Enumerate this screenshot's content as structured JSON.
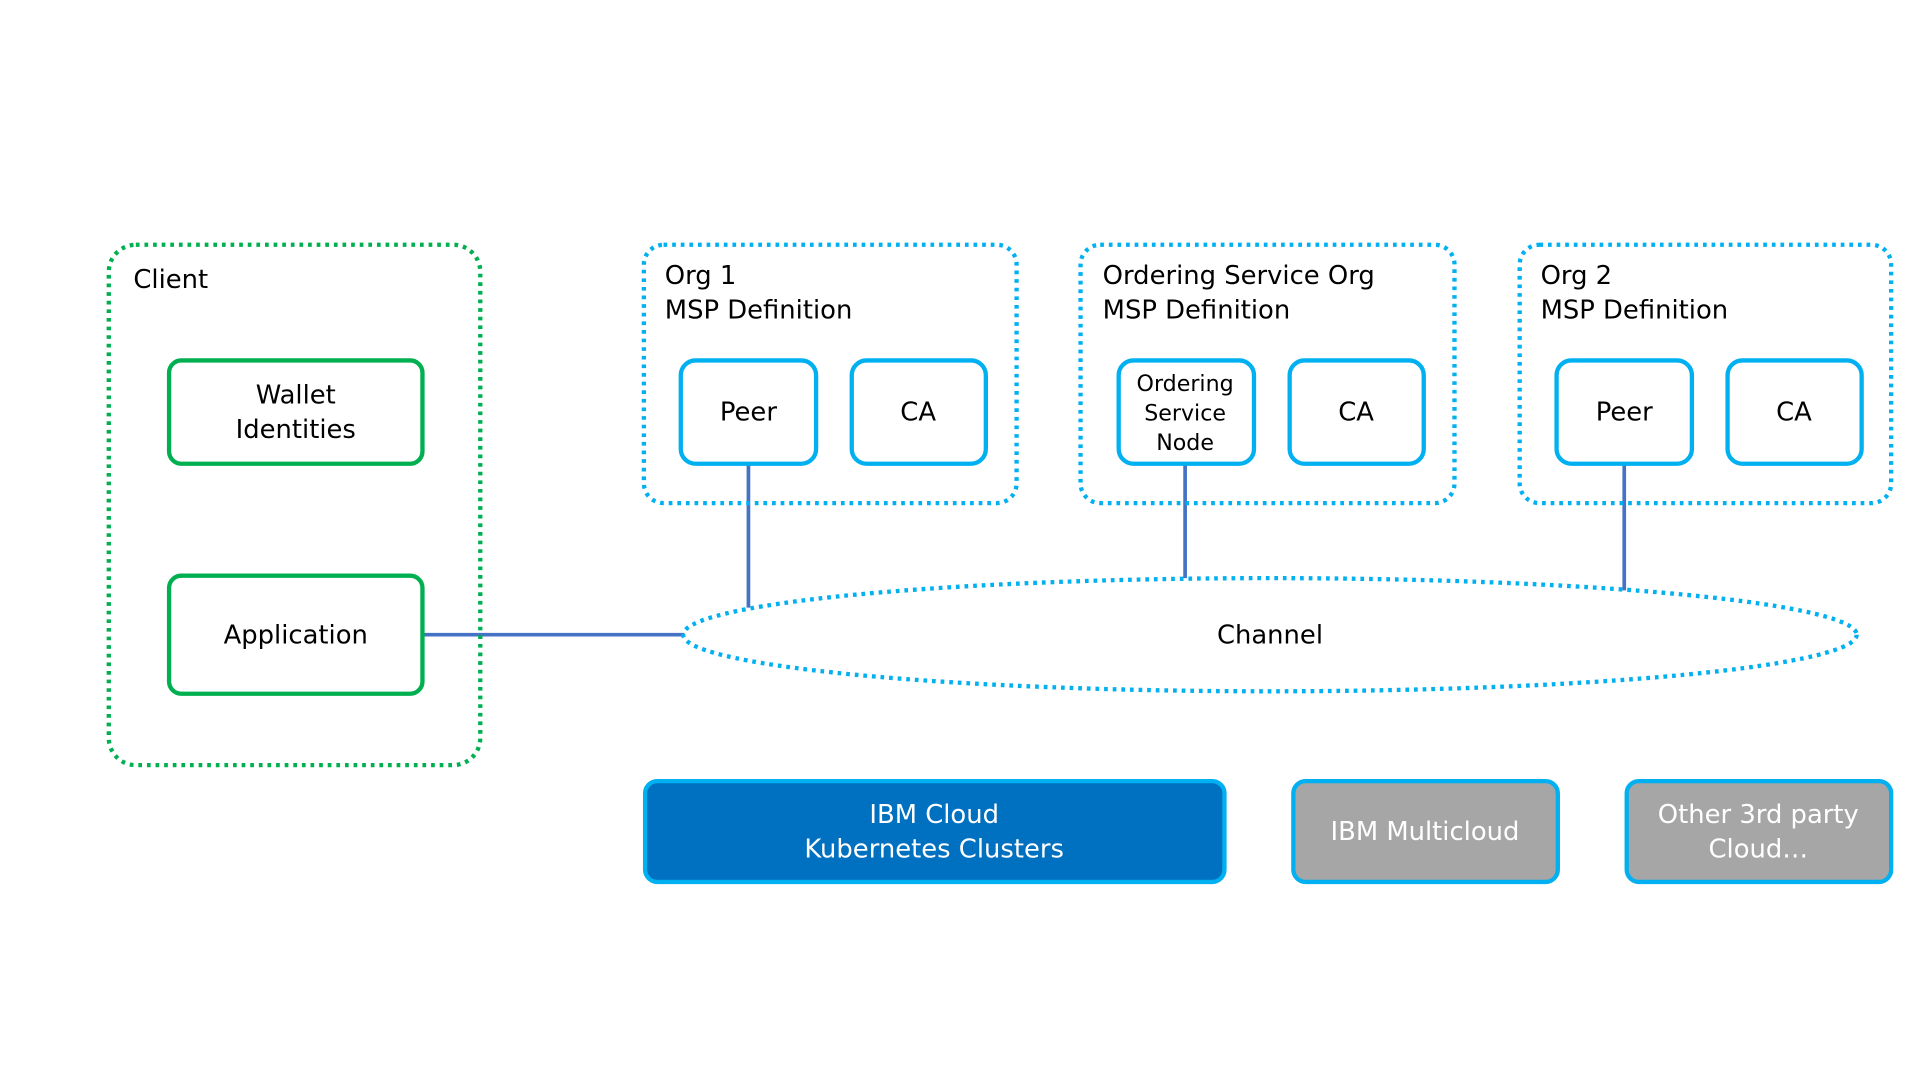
{
  "colors": {
    "client_border": "#00b050",
    "org_border": "#00b0f0",
    "connector": "#4472c4",
    "ibm_cloud_fill": "#0070c0",
    "other_cloud_fill": "#a6a6a6"
  },
  "client": {
    "title": "Client",
    "wallet": [
      "Wallet",
      "Identities"
    ],
    "application": "Application"
  },
  "org1": {
    "title": [
      "Org 1",
      "MSP Definition"
    ],
    "peer": "Peer",
    "ca": "CA"
  },
  "ordering_org": {
    "title": [
      "Ordering Service Org",
      "MSP Definition"
    ],
    "node": [
      "Ordering",
      "Service",
      "Node"
    ],
    "ca": "CA"
  },
  "org2": {
    "title": [
      "Org 2",
      "MSP Definition"
    ],
    "peer": "Peer",
    "ca": "CA"
  },
  "channel": "Channel",
  "clouds": {
    "ibm_cloud": [
      "IBM Cloud",
      "Kubernetes Clusters"
    ],
    "ibm_multicloud": "IBM Multicloud",
    "other": [
      "Other 3rd party",
      "Cloud…"
    ]
  }
}
